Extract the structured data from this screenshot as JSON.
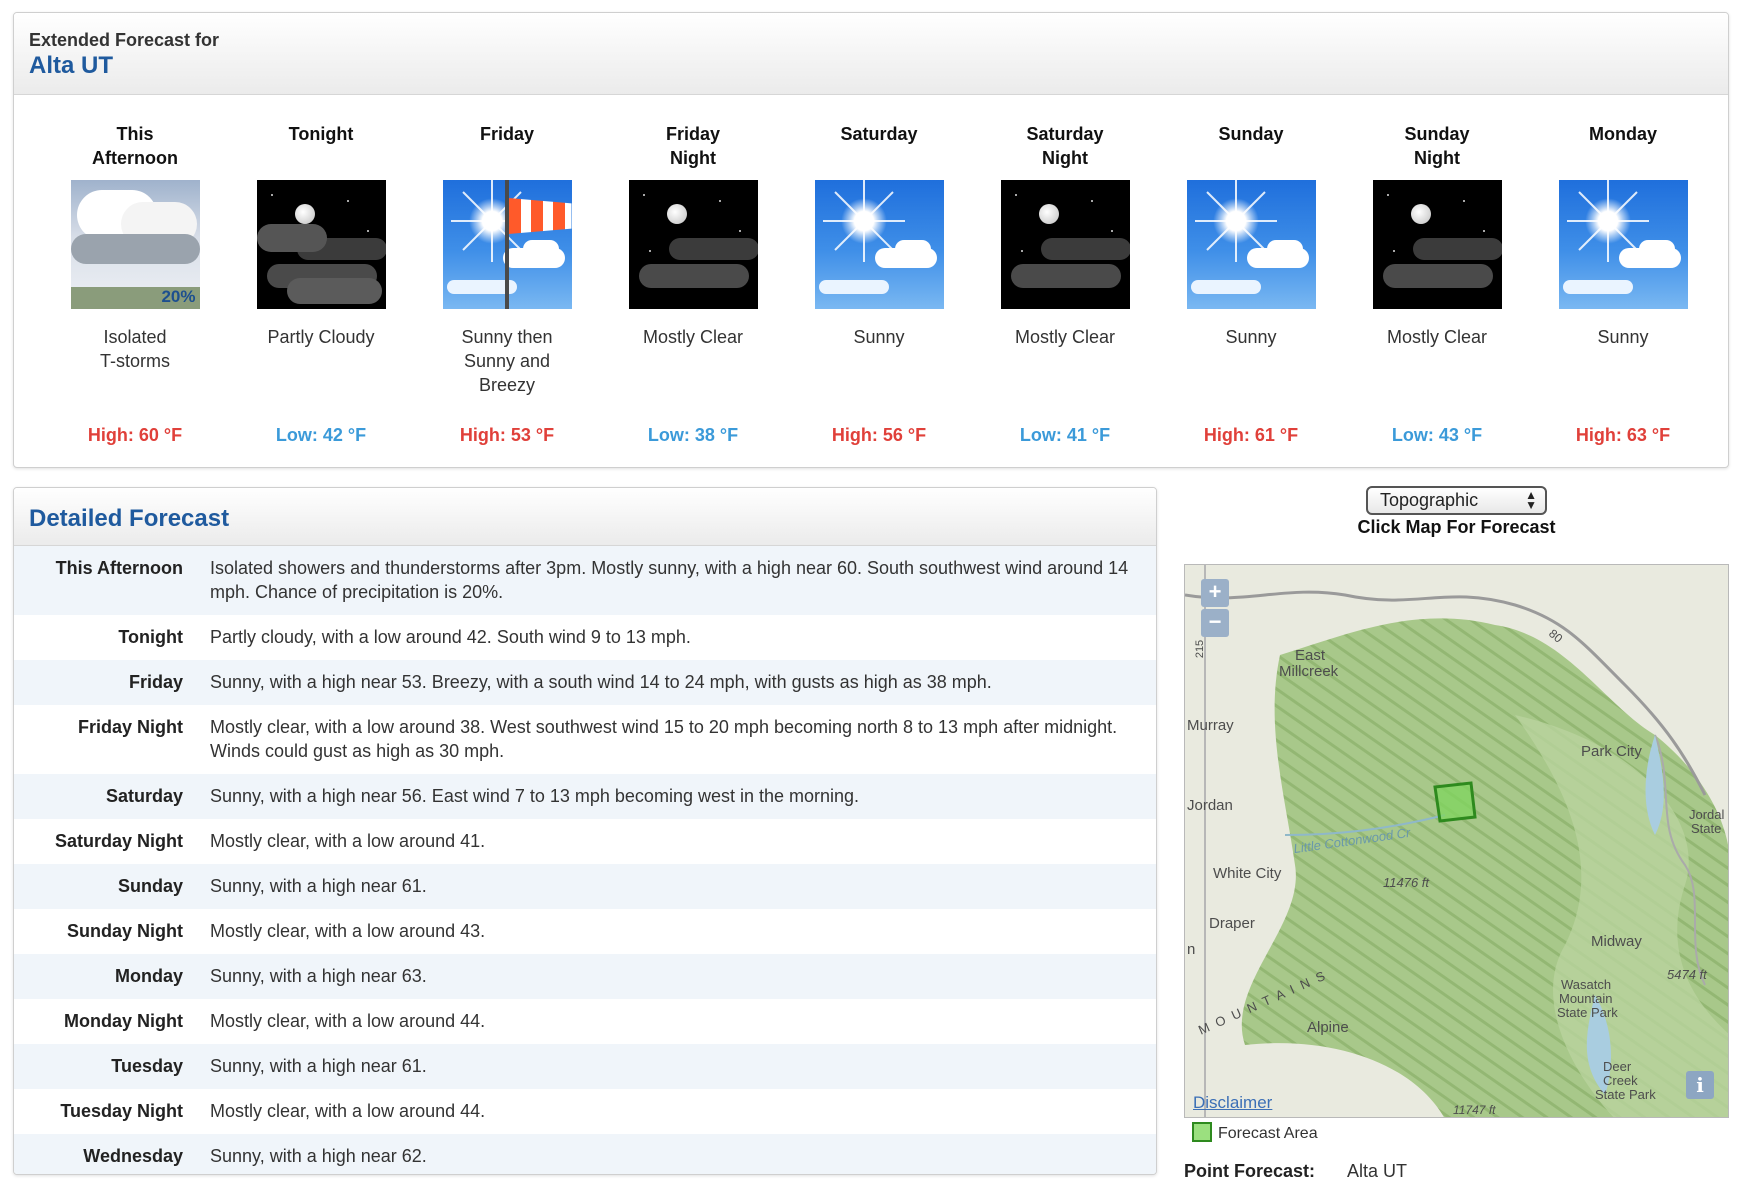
{
  "extended": {
    "label": "Extended Forecast for",
    "location": "Alta UT",
    "periods": [
      {
        "name1": "This",
        "name2": "Afternoon",
        "icon": "tstorm-icon",
        "desc1": "Isolated",
        "desc2": "T-storms",
        "desc3": "",
        "temp": "High: 60 °F",
        "kind": "high",
        "pop": "20%"
      },
      {
        "name1": "Tonight",
        "name2": "",
        "icon": "partly-cloudy-night-icon",
        "desc1": "Partly Cloudy",
        "desc2": "",
        "desc3": "",
        "temp": "Low: 42 °F",
        "kind": "low"
      },
      {
        "name1": "Friday",
        "name2": "",
        "icon": "sunny-windy-icon",
        "desc1": "Sunny then",
        "desc2": "Sunny and",
        "desc3": "Breezy",
        "temp": "High: 53 °F",
        "kind": "high"
      },
      {
        "name1": "Friday",
        "name2": "Night",
        "icon": "mostly-clear-night-icon",
        "desc1": "Mostly Clear",
        "desc2": "",
        "desc3": "",
        "temp": "Low: 38 °F",
        "kind": "low"
      },
      {
        "name1": "Saturday",
        "name2": "",
        "icon": "sunny-icon",
        "desc1": "Sunny",
        "desc2": "",
        "desc3": "",
        "temp": "High: 56 °F",
        "kind": "high"
      },
      {
        "name1": "Saturday",
        "name2": "Night",
        "icon": "mostly-clear-night-icon",
        "desc1": "Mostly Clear",
        "desc2": "",
        "desc3": "",
        "temp": "Low: 41 °F",
        "kind": "low"
      },
      {
        "name1": "Sunday",
        "name2": "",
        "icon": "sunny-icon",
        "desc1": "Sunny",
        "desc2": "",
        "desc3": "",
        "temp": "High: 61 °F",
        "kind": "high"
      },
      {
        "name1": "Sunday",
        "name2": "Night",
        "icon": "mostly-clear-night-icon",
        "desc1": "Mostly Clear",
        "desc2": "",
        "desc3": "",
        "temp": "Low: 43 °F",
        "kind": "low"
      },
      {
        "name1": "Monday",
        "name2": "",
        "icon": "sunny-icon",
        "desc1": "Sunny",
        "desc2": "",
        "desc3": "",
        "temp": "High: 63 °F",
        "kind": "high"
      }
    ]
  },
  "detailed": {
    "title": "Detailed Forecast",
    "rows": [
      {
        "label": "This Afternoon",
        "text": "Isolated showers and thunderstorms after 3pm. Mostly sunny, with a high near 60. South southwest wind around 14 mph. Chance of precipitation is 20%."
      },
      {
        "label": "Tonight",
        "text": "Partly cloudy, with a low around 42. South wind 9 to 13 mph."
      },
      {
        "label": "Friday",
        "text": "Sunny, with a high near 53. Breezy, with a south wind 14 to 24 mph, with gusts as high as 38 mph."
      },
      {
        "label": "Friday Night",
        "text": "Mostly clear, with a low around 38. West southwest wind 15 to 20 mph becoming north 8 to 13 mph after midnight. Winds could gust as high as 30 mph."
      },
      {
        "label": "Saturday",
        "text": "Sunny, with a high near 56. East wind 7 to 13 mph becoming west in the morning."
      },
      {
        "label": "Saturday Night",
        "text": "Mostly clear, with a low around 41."
      },
      {
        "label": "Sunday",
        "text": "Sunny, with a high near 61."
      },
      {
        "label": "Sunday Night",
        "text": "Mostly clear, with a low around 43."
      },
      {
        "label": "Monday",
        "text": "Sunny, with a high near 63."
      },
      {
        "label": "Monday Night",
        "text": "Mostly clear, with a low around 44."
      },
      {
        "label": "Tuesday",
        "text": "Sunny, with a high near 61."
      },
      {
        "label": "Tuesday Night",
        "text": "Mostly clear, with a low around 44."
      },
      {
        "label": "Wednesday",
        "text": "Sunny, with a high near 62."
      }
    ]
  },
  "map": {
    "layer_selected": "Topographic",
    "click_hint": "Click Map For Forecast",
    "zoom_in": "+",
    "zoom_out": "−",
    "info": "i",
    "disclaimer": "Disclaimer",
    "legend": "Forecast Area",
    "labels": {
      "east": "East",
      "millcreek": "Millcreek",
      "murray": "Murray",
      "park_city": "Park City",
      "jordan": "Jordan",
      "jordanelle1": "Jordal",
      "jordanelle2": "State",
      "little_cottonwood": "Little Cottonwood Cr",
      "white_city": "White City",
      "elev1": "11476 ft",
      "draper": "Draper",
      "n": "n",
      "midway": "Midway",
      "wasatch1": "Wasatch",
      "wasatch2": "Mountain",
      "wasatch3": "State Park",
      "elev2": "5474 ft",
      "mountains": "M O U N T A I N S",
      "alpine": "Alpine",
      "deer1": "Deer",
      "deer2": "Creek",
      "deer3": "State Park",
      "elev3": "11747 ft",
      "hwy80": "80",
      "hwy215": "215"
    },
    "colors": {
      "forest": "#a9c98a",
      "forest_dark": "#8fb56f",
      "base": "#e9eadf",
      "area": "#7fd65e",
      "area_border": "#2e8a1e"
    }
  },
  "point_forecast": {
    "label": "Point Forecast:",
    "value": "Alta UT"
  },
  "colors": {
    "high": "#e0403a",
    "low": "#3b9ad9",
    "title_blue": "#1f5a9e"
  }
}
